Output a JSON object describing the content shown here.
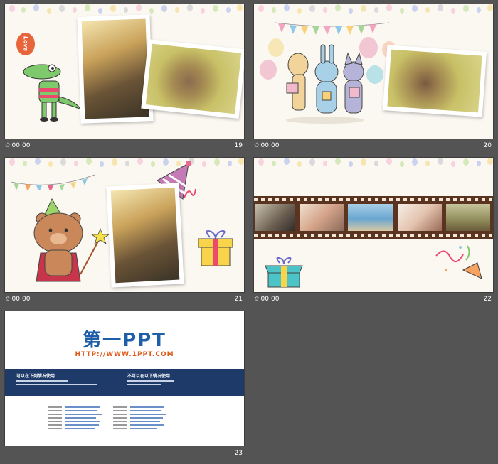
{
  "slides": [
    {
      "number": "19",
      "time": "00:00"
    },
    {
      "number": "20",
      "time": "00:00"
    },
    {
      "number": "21",
      "time": "00:00"
    },
    {
      "number": "22",
      "time": "00:00"
    },
    {
      "number": "23"
    }
  ],
  "slide1": {
    "balloon_text": "Love"
  },
  "credits": {
    "logo": "第一PPT",
    "url": "HTTP://WWW.1PPT.COM",
    "left_title": "可以在下列情况使用",
    "right_title": "不可以在以下情况使用"
  },
  "colors": {
    "background": "#545454",
    "slide_bg": "#fbf7f1",
    "navy": "#1d3a68",
    "logo_blue": "#1f5ea8",
    "url_orange": "#e05a1a"
  }
}
